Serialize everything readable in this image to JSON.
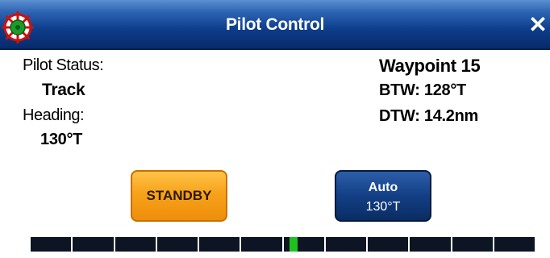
{
  "window": {
    "title": "Pilot Control",
    "close_glyph": "✕",
    "app_icon": "helm-icon"
  },
  "left": {
    "status_label": "Pilot Status:",
    "status_value": "Track",
    "heading_label": "Heading:",
    "heading_value": "130°T"
  },
  "right": {
    "waypoint": "Waypoint 15",
    "btw": "BTW: 128°T",
    "dtw": "DTW: 14.2nm"
  },
  "buttons": {
    "standby": "STANDBY",
    "auto_line1": "Auto",
    "auto_line2": "130°T"
  },
  "xte_bar": {
    "segments": 12,
    "marker_position": 0.5
  },
  "colors": {
    "title_bar": "#0d3d8c",
    "standby_button": "#f7a21a",
    "auto_button": "#123f84",
    "bar_segment": "#0d1524",
    "marker": "#1ec21e"
  }
}
